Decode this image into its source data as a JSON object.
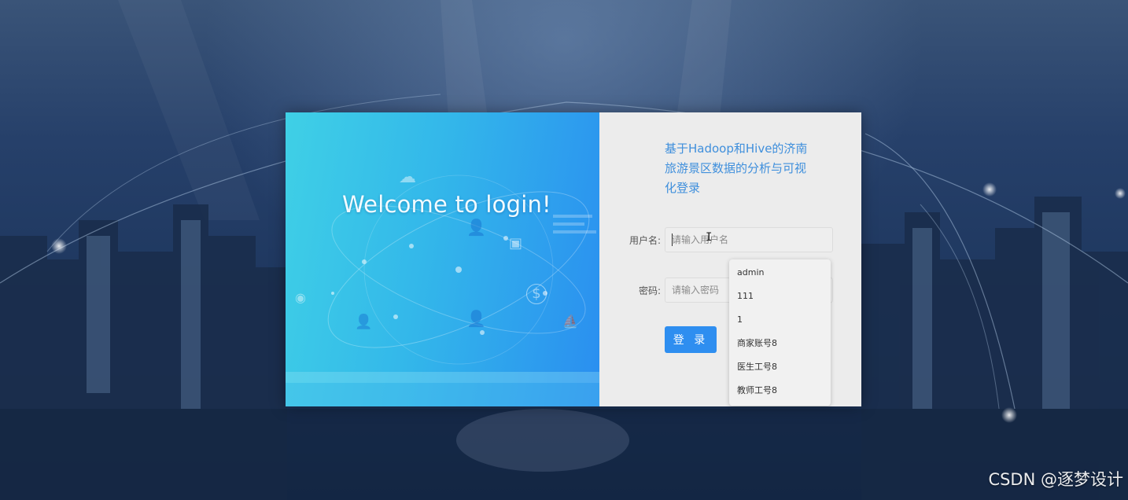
{
  "colors": {
    "accent": "#2e8ef0",
    "title_text": "#3f8fdc",
    "panel_bg": "#ececec",
    "left_panel_start": "#3fd0e6",
    "left_panel_end": "#2a8ef0"
  },
  "left_panel": {
    "welcome_text": "Welcome to login!",
    "icons": [
      "cloud-icon",
      "user-icon",
      "briefcase-icon",
      "camera-icon",
      "dollar-icon",
      "user-icon",
      "user-icon",
      "boat-icon"
    ]
  },
  "form": {
    "title": "基于Hadoop和Hive的济南旅游景区数据的分析与可视化登录",
    "username_label": "用户名:",
    "username_placeholder": "请输入用户名",
    "password_label": "密码:",
    "password_placeholder": "请输入密码",
    "login_button": "登 录"
  },
  "autocomplete": {
    "items": [
      {
        "label": "admin"
      },
      {
        "label": "111"
      },
      {
        "label": "1"
      },
      {
        "label": "商家账号8"
      },
      {
        "label": "医生工号8"
      },
      {
        "label": "教师工号8"
      }
    ]
  },
  "watermark": "CSDN @逐梦设计"
}
